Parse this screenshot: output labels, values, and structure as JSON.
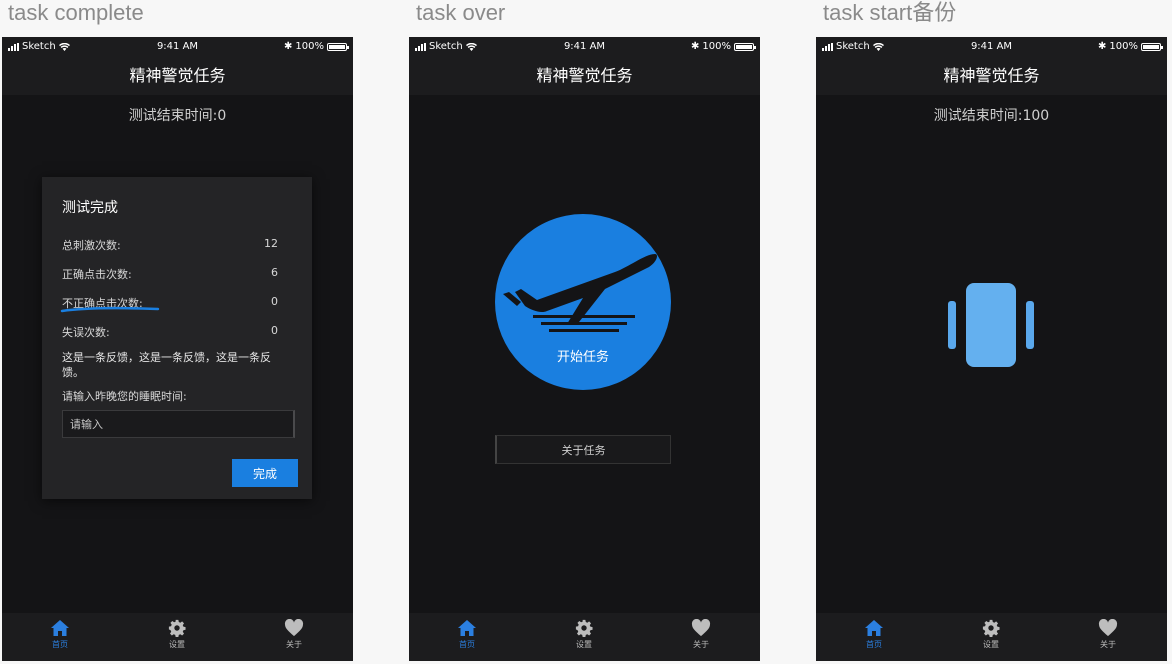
{
  "artboards": [
    {
      "label": "task complete",
      "status": {
        "carrier": "Sketch",
        "time": "9:41 AM",
        "battery": "100%"
      },
      "title": "精神警觉任务",
      "timer_text": "测试结束时间:0",
      "dialog": {
        "title": "测试完成",
        "stats": [
          {
            "label": "总刺激次数:",
            "value": "12"
          },
          {
            "label": "正确点击次数:",
            "value": "6"
          },
          {
            "label": "不正确点击次数:",
            "value": "0"
          },
          {
            "label": "失误次数:",
            "value": "0"
          }
        ],
        "feedback": "这是一条反馈，这是一条反馈，这是一条反馈。",
        "sleep_label": "请输入昨晚您的睡眠时间:",
        "sleep_placeholder": "请输入",
        "done_label": "完成"
      },
      "tabs": [
        {
          "label": "首页",
          "icon": "home-icon",
          "active": true
        },
        {
          "label": "设置",
          "icon": "gear-icon",
          "active": false
        },
        {
          "label": "关于",
          "icon": "heart-icon",
          "active": false
        }
      ]
    },
    {
      "label": "task over",
      "status": {
        "carrier": "Sketch",
        "time": "9:41 AM",
        "battery": "100%"
      },
      "title": "精神警觉任务",
      "start_label": "开始任务",
      "start_icon": "airplane-takeoff-icon",
      "about_label": "关于任务",
      "tabs": [
        {
          "label": "首页",
          "icon": "home-icon",
          "active": true
        },
        {
          "label": "设置",
          "icon": "gear-icon",
          "active": false
        },
        {
          "label": "关于",
          "icon": "heart-icon",
          "active": false
        }
      ]
    },
    {
      "label": "task start备份",
      "status": {
        "carrier": "Sketch",
        "time": "9:41 AM",
        "battery": "100%"
      },
      "title": "精神警觉任务",
      "timer_text": "测试结束时间:100",
      "center_icon": "vibrating-phone-icon",
      "tabs": [
        {
          "label": "首页",
          "icon": "home-icon",
          "active": true
        },
        {
          "label": "设置",
          "icon": "gear-icon",
          "active": false
        },
        {
          "label": "关于",
          "icon": "heart-icon",
          "active": false
        }
      ]
    }
  ],
  "colors": {
    "accent": "#1a7fe0",
    "screen_bg": "#141416",
    "bar_bg": "#1c1c1e",
    "dialog_bg": "#242426",
    "canvas_bg": "#f7f7f7"
  }
}
